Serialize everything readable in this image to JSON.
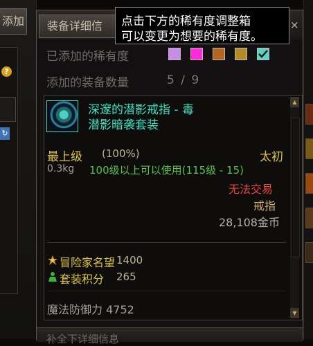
{
  "left_panel": {
    "add_tab_label": "添加",
    "help_label": "?",
    "sync_label": "↻"
  },
  "window": {
    "tab_label": "装备详细信",
    "close_label": "×",
    "rarity_row_label": "已添加的稀有度",
    "rarity_swatches": [
      {
        "name": "rare",
        "color": "#c98ae8"
      },
      {
        "name": "unique",
        "color": "#ff2cdc"
      },
      {
        "name": "legendary",
        "color": "#b4651f"
      },
      {
        "name": "epic",
        "color": "#b28d25"
      },
      {
        "name": "mythic-checked",
        "color": "#5ed4c0",
        "checked": true
      }
    ],
    "count_row_label": "添加的装备数量",
    "count_value": "5 / 9",
    "bottom_bar_label": "补全下详细信息"
  },
  "item": {
    "name": "深邃的潜影戒指 - 毒",
    "set_name": "潜影暗袭套装",
    "rarity": "最上级",
    "rarity_percent": "(100%)",
    "tier": "太初",
    "weight": "0.3kg",
    "level_requirement": "100级以上可以使用(115级 - 15)",
    "tradability": "无法交易",
    "type": "戒指",
    "price": "28,108金币",
    "fame_label": "冒险家名望",
    "fame_value": "1400",
    "set_points_label": "套装积分",
    "set_points_value": "265",
    "magic_defense": "魔法防御力 4752"
  },
  "tooltip": {
    "line1": "点击下方的稀有度调整箱",
    "line2": "可以变更为想要的稀有度。"
  },
  "icons": [
    "help-icon",
    "sync-icon",
    "close-icon",
    "ring-icon",
    "fame-icon",
    "set-points-icon",
    "check-icon",
    "scroll-up-icon",
    "scroll-down-icon"
  ]
}
